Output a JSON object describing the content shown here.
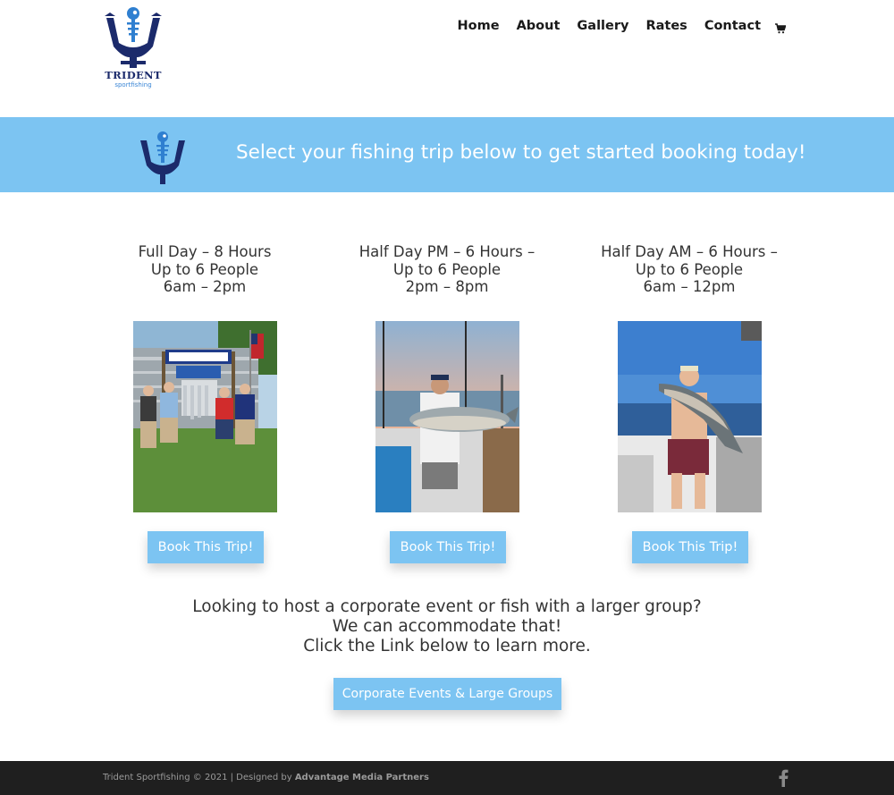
{
  "brand": {
    "logo_text": "TRIDENT",
    "logo_subtext": "sportfishing",
    "icon": "trident-fish-logo"
  },
  "nav": {
    "items": [
      {
        "label": "Home"
      },
      {
        "label": "About"
      },
      {
        "label": "Gallery"
      },
      {
        "label": "Rates"
      },
      {
        "label": "Contact"
      }
    ],
    "cart_icon": "cart-icon"
  },
  "banner": {
    "text": "Select your fishing trip below to get started booking today!",
    "background": "#7cc4f2"
  },
  "trips": [
    {
      "line1": "Full Day – 8 Hours",
      "line2": "Up to 6 People",
      "line3": "6am – 2pm",
      "photo": "group-with-catch-at-pointe-marine-sign",
      "button": "Book This Trip!"
    },
    {
      "line1": "Half Day PM – 6 Hours –",
      "line2": "Up to 6 People",
      "line3": "2pm – 8pm",
      "photo": "angler-holding-salmon-at-sunset",
      "button": "Book This Trip!"
    },
    {
      "line1": "Half Day AM – 6 Hours –",
      "line2": "Up to 6 People",
      "line3": "6am – 12pm",
      "photo": "angler-holding-salmon-on-boat",
      "button": "Book This Trip!"
    }
  ],
  "corporate": {
    "line1": "Looking to host a corporate event or fish with a larger group?",
    "line2": "We can accommodate that!",
    "line3": "Click the Link below to learn more.",
    "button": "Corporate Events & Large Groups"
  },
  "footer": {
    "copyright": "Trident Sportfishing © 2021 | Designed by ",
    "designer": "Advantage Media Partners",
    "social_icon": "facebook-icon"
  },
  "colors": {
    "accent": "#7cc4f2",
    "logo_navy": "#1b2a6b",
    "footer_bg": "#1f1f1f"
  }
}
